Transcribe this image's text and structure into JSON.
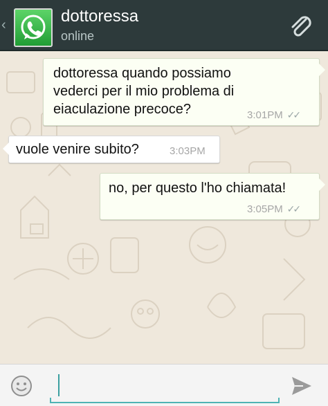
{
  "header": {
    "back_icon": "chevron-left-icon",
    "avatar_icon": "whatsapp-logo-icon",
    "contact_name": "dottoressa",
    "status": "online",
    "attach_icon": "paperclip-icon",
    "colors": {
      "bar": "#2d3a3b",
      "title": "#ffffff",
      "status": "#b8c6c6"
    }
  },
  "messages": [
    {
      "direction": "outgoing",
      "text": "dottoressa quando possiamo\nvederci per il mio problema di\neiaculazione precoce?",
      "time": "3:01PM",
      "status_icon": "double-check-icon"
    },
    {
      "direction": "incoming",
      "text": "vuole venire subito?",
      "time": "3:03PM"
    },
    {
      "direction": "outgoing",
      "text": "no, per questo l'ho chiamata!",
      "time": "3:05PM",
      "status_icon": "double-check-icon"
    }
  ],
  "composer": {
    "emoji_icon": "smiley-icon",
    "value": "",
    "send_icon": "send-arrow-icon",
    "accent": "#4eb3b4"
  }
}
